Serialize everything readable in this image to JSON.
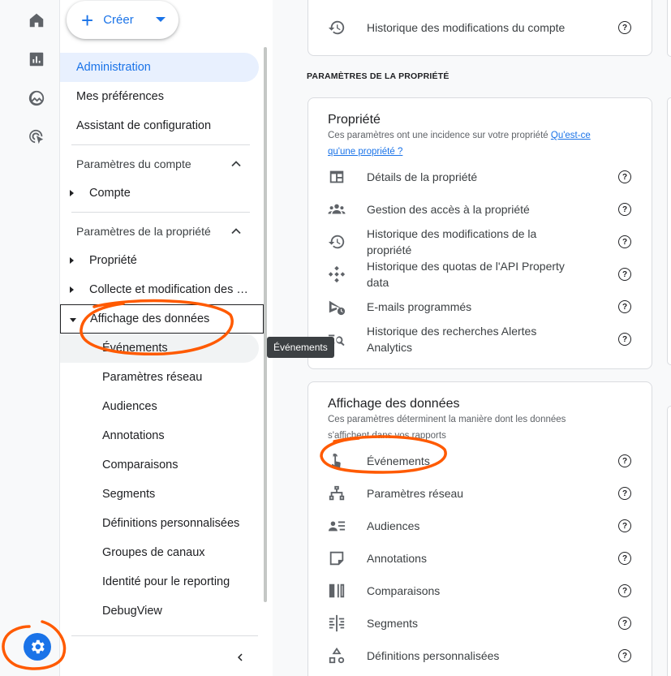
{
  "rail": {
    "icons": [
      "home-icon",
      "reports-icon",
      "explore-icon",
      "advertising-icon"
    ],
    "admin_icon": "gear-icon"
  },
  "nav": {
    "create_label": "Créer",
    "top_items": [
      "Administration",
      "Mes préférences",
      "Assistant de configuration"
    ],
    "account_section": "Paramètres du compte",
    "account_item": "Compte",
    "property_section": "Paramètres de la propriété",
    "property_items": [
      "Propriété",
      "Collecte et modification des …",
      "Affichage des données"
    ],
    "data_display_subitems": [
      "Événements",
      "Paramètres réseau",
      "Audiences",
      "Annotations",
      "Comparaisons",
      "Segments",
      "Définitions personnalisées",
      "Groupes de canaux",
      "Identité pour le reporting",
      "DebugView"
    ]
  },
  "tooltip": "Événements",
  "main": {
    "top_card_row": "Historique des modifications du compte",
    "section_label": "PARAMÈTRES DE LA PROPRIÉTÉ",
    "property_card": {
      "title": "Propriété",
      "description": "Ces paramètres ont une incidence sur votre propriété",
      "link": "Qu'est-ce qu'une propriété ?",
      "rows": [
        "Détails de la propriété",
        "Gestion des accès à la propriété",
        "Historique des modifications de la propriété",
        "Historique des quotas de l'API Property data",
        "E-mails programmés",
        "Historique des recherches Alertes Analytics"
      ]
    },
    "display_card": {
      "title": "Affichage des données",
      "description": "Ces paramètres déterminent la manière dont les données s'affichent dans vos rapports",
      "rows": [
        "Événements",
        "Paramètres réseau",
        "Audiences",
        "Annotations",
        "Comparaisons",
        "Segments",
        "Définitions personnalisées"
      ]
    },
    "help_glyph": "?"
  },
  "colors": {
    "accent": "#1a73e8",
    "annotation": "#ff5a00",
    "active_bg": "#e8f0fe"
  }
}
